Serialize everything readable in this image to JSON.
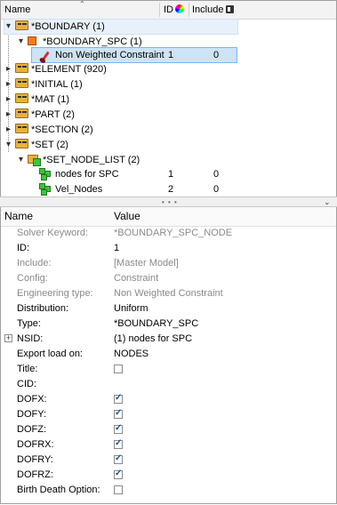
{
  "tree": {
    "columns": {
      "name": "Name",
      "id": "ID",
      "include": "Include"
    },
    "rows": [
      {
        "label": "*BOUNDARY  (1)"
      },
      {
        "label": "*BOUNDARY_SPC  (1)"
      },
      {
        "label": "Non Weighted Constraint",
        "id": "1",
        "include": "0"
      },
      {
        "label": "*ELEMENT  (920)"
      },
      {
        "label": "*INITIAL  (1)"
      },
      {
        "label": "*MAT  (1)"
      },
      {
        "label": "*PART  (2)"
      },
      {
        "label": "*SECTION  (2)"
      },
      {
        "label": "*SET  (2)"
      },
      {
        "label": "*SET_NODE_LIST  (2)"
      },
      {
        "label": "nodes for SPC",
        "id": "1",
        "include": "0"
      },
      {
        "label": "Vel_Nodes",
        "id": "2",
        "include": "0"
      }
    ]
  },
  "properties": {
    "header": {
      "name": "Name",
      "value": "Value"
    },
    "rows": [
      {
        "label": "Solver Keyword:",
        "value": "*BOUNDARY_SPC_NODE"
      },
      {
        "label": "ID:",
        "value": "1"
      },
      {
        "label": "Include:",
        "value": "[Master Model]"
      },
      {
        "label": "Config:",
        "value": "Constraint"
      },
      {
        "label": "Engineering type:",
        "value": "Non Weighted Constraint"
      },
      {
        "label": "Distribution:",
        "value": "Uniform"
      },
      {
        "label": "Type:",
        "value": "*BOUNDARY_SPC"
      },
      {
        "label": "NSID:",
        "value": "(1) nodes for SPC"
      },
      {
        "label": "Export load on:",
        "value": "NODES"
      },
      {
        "label": "Title:",
        "checked": false
      },
      {
        "label": "CID:",
        "value": ""
      },
      {
        "label": "DOFX:",
        "checked": true
      },
      {
        "label": "DOFY:",
        "checked": true
      },
      {
        "label": "DOFZ:",
        "checked": true
      },
      {
        "label": "DOFRX:",
        "checked": true
      },
      {
        "label": "DOFRY:",
        "checked": true
      },
      {
        "label": "DOFRZ:",
        "checked": true
      },
      {
        "label": "Birth Death Option:",
        "checked": false
      }
    ]
  }
}
